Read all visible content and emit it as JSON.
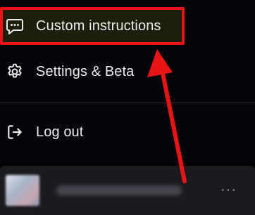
{
  "menu": {
    "items": [
      {
        "label": "Custom instructions",
        "icon": "message-dots-icon"
      },
      {
        "label": "Settings & Beta",
        "icon": "gear-icon"
      },
      {
        "label": "Log out",
        "icon": "logout-icon"
      }
    ]
  },
  "profile": {
    "more_label": "···"
  },
  "annotation": {
    "highlight_color": "#e81416",
    "arrow_color": "#e81416"
  }
}
